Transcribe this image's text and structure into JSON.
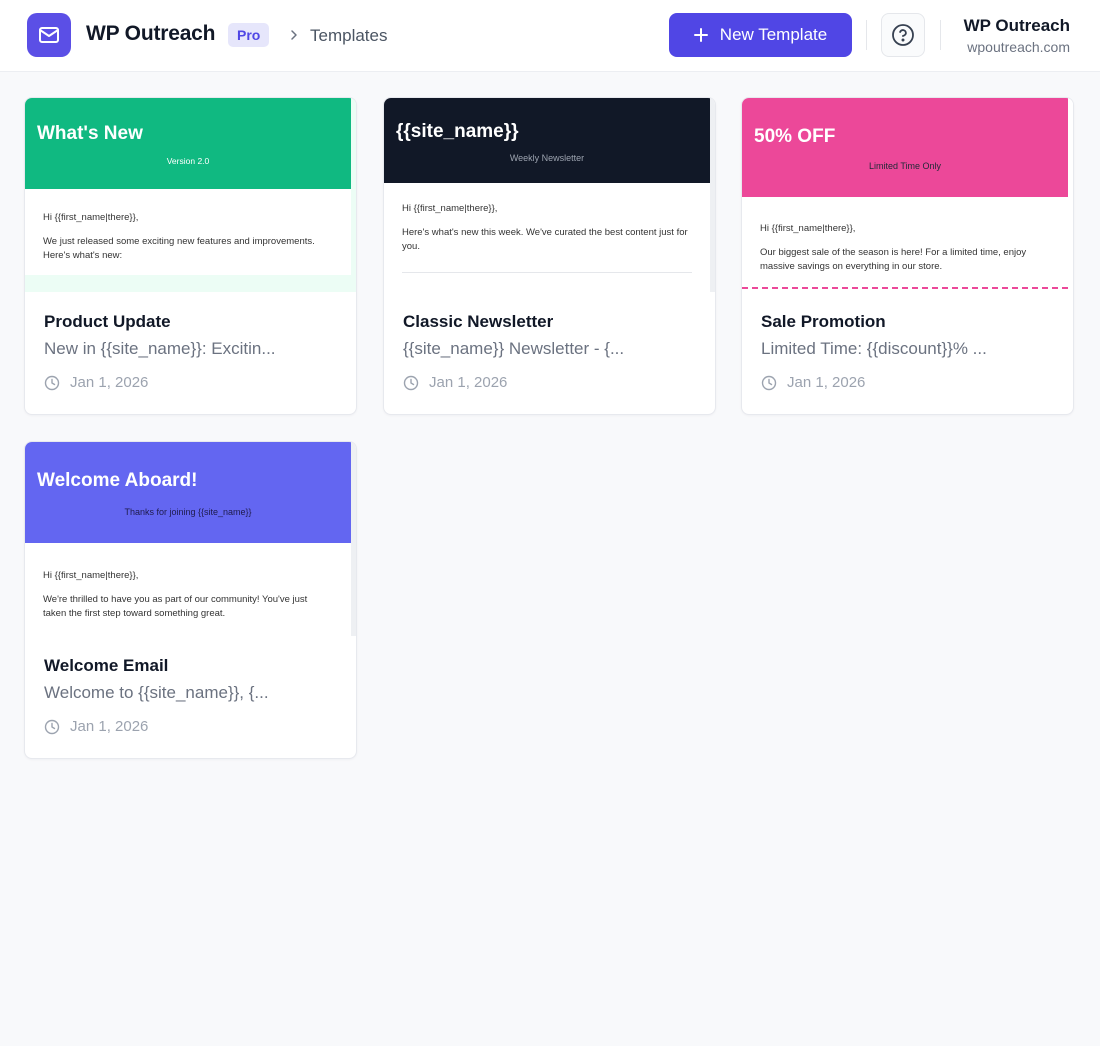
{
  "header": {
    "brand": "WP Outreach",
    "badge": "Pro",
    "breadcrumb": "Templates",
    "new_button": "New Template",
    "account_name": "WP Outreach",
    "account_site": "wpoutreach.com"
  },
  "colors": {
    "accent": "#5046e5",
    "logo_bg": "#5b4fe6",
    "green": "#10b981",
    "dark": "#111827",
    "pink": "#ec4899",
    "indigo": "#6366f1"
  },
  "icons": {
    "logo": "mail-icon",
    "breadcrumb": "chevron-right-icon",
    "new": "plus-icon",
    "help": "help-circle-icon",
    "date": "clock-icon"
  },
  "cards": [
    {
      "preview": {
        "title": "What's New",
        "subtitle": "Version 2.0",
        "greeting": "Hi {{first_name|there}},",
        "body": "We just released some exciting new features and improvements. Here's what's new:"
      },
      "title": "Product Update",
      "subject": "New in {{site_name}}: Excitin...",
      "date": "Jan 1, 2026"
    },
    {
      "preview": {
        "title": "{{site_name}}",
        "subtitle": "Weekly Newsletter",
        "greeting": "Hi {{first_name|there}},",
        "body": "Here's what's new this week. We've curated the best content just for you."
      },
      "title": "Classic Newsletter",
      "subject": "{{site_name}} Newsletter - {...",
      "date": "Jan 1, 2026"
    },
    {
      "preview": {
        "title": "50% OFF",
        "subtitle": "Limited Time Only",
        "greeting": "Hi {{first_name|there}},",
        "body": "Our biggest sale of the season is here! For a limited time, enjoy massive savings on everything in our store."
      },
      "title": "Sale Promotion",
      "subject": "Limited Time: {{discount}}% ...",
      "date": "Jan 1, 2026"
    },
    {
      "preview": {
        "title": "Welcome Aboard!",
        "subtitle": "Thanks for joining {{site_name}}",
        "greeting": "Hi {{first_name|there}},",
        "body": "We're thrilled to have you as part of our community! You've just taken the first step toward something great."
      },
      "title": "Welcome Email",
      "subject": "Welcome to {{site_name}}, {...",
      "date": "Jan 1, 2026"
    }
  ]
}
